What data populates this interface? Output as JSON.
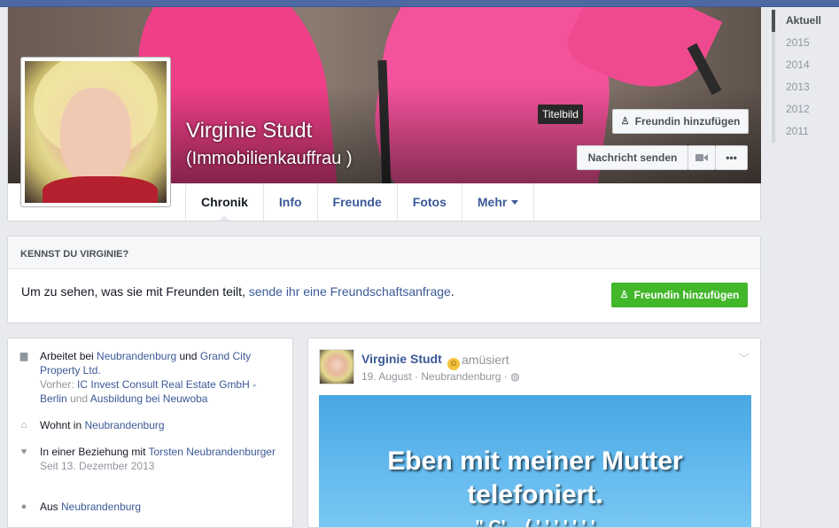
{
  "cover": {
    "name": "Virginie Studt",
    "subtitle": "(Immobilienkauffrau )",
    "tooltip": "Titelbild",
    "add_friend_label": "Freundin hinzufügen",
    "message_label": "Nachricht senden",
    "more_label": "•••"
  },
  "tabs": [
    {
      "label": "Chronik"
    },
    {
      "label": "Info"
    },
    {
      "label": "Freunde"
    },
    {
      "label": "Fotos"
    },
    {
      "label": "Mehr"
    }
  ],
  "know": {
    "heading": "KENNST DU VIRGINIE?",
    "text_before": "Um zu sehen, was sie mit Freunden teilt, ",
    "link": "sende ihr eine Freundschaftsanfrage",
    "text_after": ".",
    "button": "Freundin hinzufügen"
  },
  "info": {
    "work_prefix": "Arbeitet bei ",
    "work_1": "Neubrandenburg",
    "work_and": " und ",
    "work_2": "Grand City Property Ltd.",
    "prev_prefix": "Vorher: ",
    "prev_1": "IC Invest Consult Real Estate GmbH - Berlin",
    "prev_and": " und ",
    "prev_2": "Ausbildung bei Neuwoba",
    "lives_prefix": "Wohnt in ",
    "lives": "Neubrandenburg",
    "rel_prefix": "In einer Beziehung mit ",
    "rel_name": "Torsten Neubrandenburger",
    "rel_since": "Seit 13. Dezember 2013",
    "from_prefix": "Aus ",
    "from": "Neubrandenburg"
  },
  "post": {
    "author": "Virginie Studt",
    "feeling": "amüsiert",
    "meta": "19. August · Neubrandenburg ·",
    "image_line1": "Eben mit meiner Mutter",
    "image_line2": "telefoniert.",
    "image_line3": "\" Ç'... ( ' ' ' ' ' ' '"
  },
  "timeline": [
    "Aktuell",
    "2015",
    "2014",
    "2013",
    "2012",
    "2011"
  ],
  "colors": {
    "link": "#3b5998",
    "green": "#42b72a",
    "topbar": "#4e69a2",
    "cover_pink": "#f0448a"
  }
}
